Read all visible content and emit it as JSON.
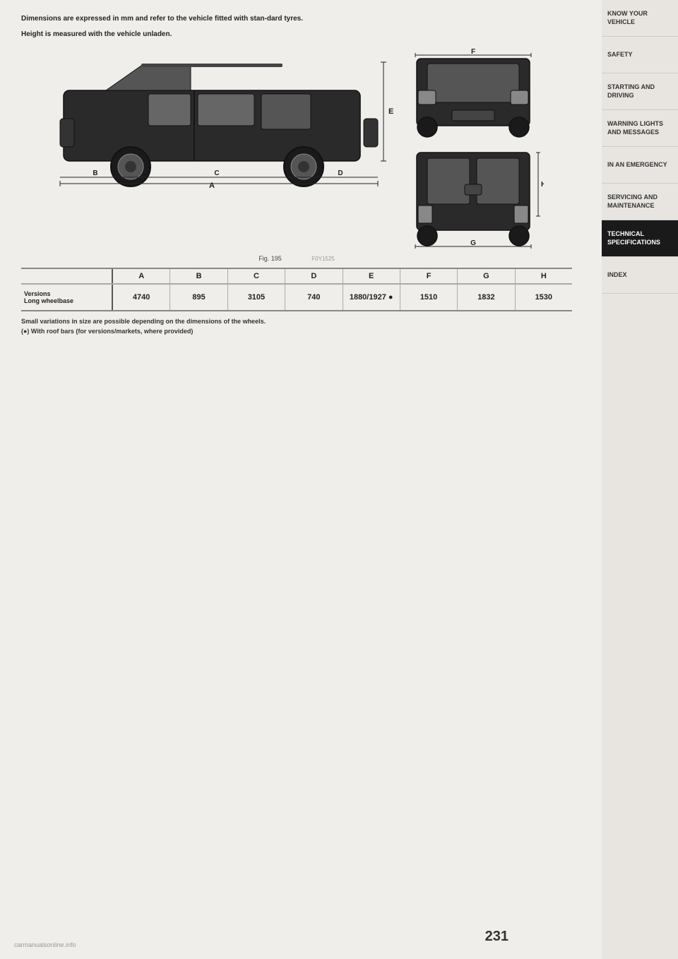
{
  "sidebar": {
    "items": [
      {
        "label": "KNOW YOUR VEHICLE",
        "active": false
      },
      {
        "label": "SAFETY",
        "active": false
      },
      {
        "label": "STARTING AND DRIVING",
        "active": false
      },
      {
        "label": "WARNING LIGHTS AND MESSAGES",
        "active": false
      },
      {
        "label": "IN AN EMERGENCY",
        "active": false
      },
      {
        "label": "SERVICING AND MAINTENANCE",
        "active": false
      },
      {
        "label": "TECHNICAL SPECIFICATIONS",
        "active": true
      },
      {
        "label": "INDEX",
        "active": false
      }
    ]
  },
  "page": {
    "number": "231",
    "fig_caption": "Fig. 195",
    "fig_ref": "F0Y1525"
  },
  "intro": {
    "line1": "Dimensions are expressed in mm and refer to the vehicle fitted with stan-dard tyres.",
    "line2": "Height is measured with the vehicle unladen."
  },
  "columns": [
    "A",
    "B",
    "C",
    "D",
    "E",
    "F",
    "G",
    "H"
  ],
  "table": {
    "header": [
      "A",
      "B",
      "C",
      "D",
      "E",
      "F",
      "G",
      "H"
    ],
    "row": {
      "label1": "Versions",
      "label2": "Long wheelbase",
      "values": [
        "4740",
        "895",
        "3105",
        "740",
        "1880/1927 ●",
        "1510",
        "1832",
        "1530"
      ]
    }
  },
  "footnotes": {
    "line1": "Small variations in size are possible depending on the dimensions of the wheels.",
    "line2": "(●) With roof bars (for versions/markets, where provided)"
  },
  "watermark": "carmanualsonline.info"
}
